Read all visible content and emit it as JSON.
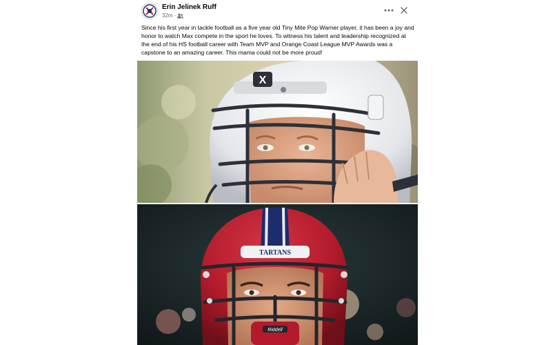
{
  "post": {
    "author": "Erin Jelinek Ruff",
    "timestamp": "32m",
    "separator": "·",
    "audience_icon": "friends-icon",
    "more_icon": "more-options-icon",
    "close_icon": "close-icon",
    "caption": "Since his first year in tackle football as a five year old Tiny Mite Pop Warner player, it has been a joy and honor to watch Max compete in the sport he loves. To witness his talent and leadership recognized at the end of his HS football career with Team MVP and Orange Coast League MVP Awards was a capstone to an amazing career. This mama could not be more proud!"
  },
  "photos": {
    "top": {
      "helmet_logo": "X"
    },
    "bottom": {
      "helmet_text": "TARTANS",
      "facemask_brand": "Riddell"
    }
  },
  "colors": {
    "accent_red": "#b31b2c",
    "navy": "#1d2c6b",
    "text_primary": "#050505",
    "text_secondary": "#65676b"
  }
}
